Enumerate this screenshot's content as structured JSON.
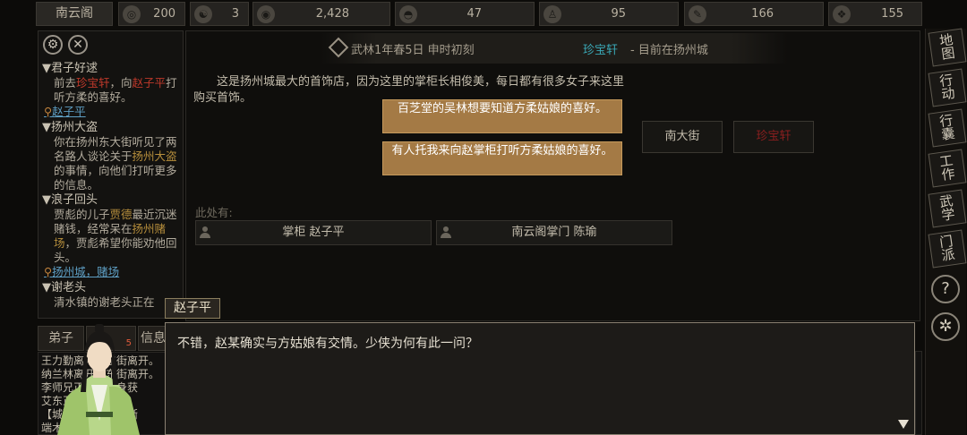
{
  "topbar": {
    "sect_name": "南云阁",
    "stats": [
      {
        "icon": "globe-icon",
        "glyph": "◎",
        "value": "200"
      },
      {
        "icon": "yin-yang-icon",
        "glyph": "☯",
        "value": "3"
      },
      {
        "icon": "coin-icon",
        "glyph": "◉",
        "value": "2,428"
      },
      {
        "icon": "food-bowl-icon",
        "glyph": "◓",
        "value": "47"
      },
      {
        "icon": "figure-icon",
        "glyph": "♙",
        "value": "95"
      },
      {
        "icon": "brush-icon",
        "glyph": "✎",
        "value": "166"
      },
      {
        "icon": "ore-icon",
        "glyph": "❖",
        "value": "155"
      }
    ]
  },
  "quests": {
    "settings_glyph": "⚙",
    "close_glyph": "✕",
    "items": [
      {
        "title": "君子好逑",
        "body_parts": [
          {
            "t": "前去",
            "c": ""
          },
          {
            "t": "珍宝轩",
            "c": "red"
          },
          {
            "t": "，向",
            "c": ""
          },
          {
            "t": "赵子平",
            "c": "red"
          },
          {
            "t": "打听方柔的喜好。",
            "c": ""
          }
        ],
        "location": "赵子平"
      },
      {
        "title": "扬州大盗",
        "body_parts": [
          {
            "t": "你在扬州东大街听见了两名路人谈论关于",
            "c": ""
          },
          {
            "t": "扬州大盗",
            "c": "gold"
          },
          {
            "t": "的事情，向他们打听更多的信息。",
            "c": ""
          }
        ],
        "location": ""
      },
      {
        "title": "浪子回头",
        "body_parts": [
          {
            "t": "贾彪的儿子",
            "c": ""
          },
          {
            "t": "贾德",
            "c": "gold"
          },
          {
            "t": "最近沉迷赌钱，经常呆在",
            "c": ""
          },
          {
            "t": "扬州赌场",
            "c": "gold"
          },
          {
            "t": "，贾彪希望你能劝他回头。",
            "c": ""
          }
        ],
        "location": "扬州城，赌场"
      },
      {
        "title": "谢老头",
        "body_parts": [
          {
            "t": "清水镇的谢老头正在",
            "c": ""
          }
        ],
        "location": ""
      }
    ]
  },
  "banner": {
    "date": "武林1年春5日 申时初刻",
    "location": "珍宝轩",
    "status": "- 目前在扬州城"
  },
  "description": "这是扬州城最大的首饰店，因为这里的掌柜长相俊美，每日都有很多女子来这里购买首饰。",
  "choices": [
    "百芝堂的吴林想要知道方柔姑娘的喜好。",
    "有人托我来向赵掌柜打听方柔姑娘的喜好。"
  ],
  "exits": [
    {
      "label": "南大街",
      "color": "#c4bdad"
    },
    {
      "label": "珍宝轩",
      "color": "#8c1f1f"
    }
  ],
  "here": {
    "label": "此处有:",
    "npcs": [
      "掌柜 赵子平",
      "南云阁掌门 陈瑜"
    ]
  },
  "side_menu": {
    "items": [
      "地图",
      "行动",
      "行囊",
      "工作",
      "武学",
      "门派"
    ],
    "help_glyph": "?",
    "settings_glyph": "✲"
  },
  "bottom_tabs": {
    "disciples": "弟子",
    "badge": "5",
    "mail": "信息"
  },
  "log_lines": [
    "王力勤离开了东街离开。",
    "纳兰林离开了东街离开。",
    "李师兄正在修炼身获",
    "艾东正在修炼渐渐",
    "【城】正在修炼渐渐",
    "端木正在修炼小夹"
  ],
  "dialog": {
    "speaker": "赵子平",
    "text": "不错，赵某确实与方姑娘有交情。少侠为何有此一问？"
  },
  "colors": {
    "choice_bg": "#a47a45",
    "location_accent": "#3aa8b6",
    "quest_red": "#c0392b",
    "quest_gold": "#b68e3c",
    "link_blue": "#5e9fc4"
  }
}
